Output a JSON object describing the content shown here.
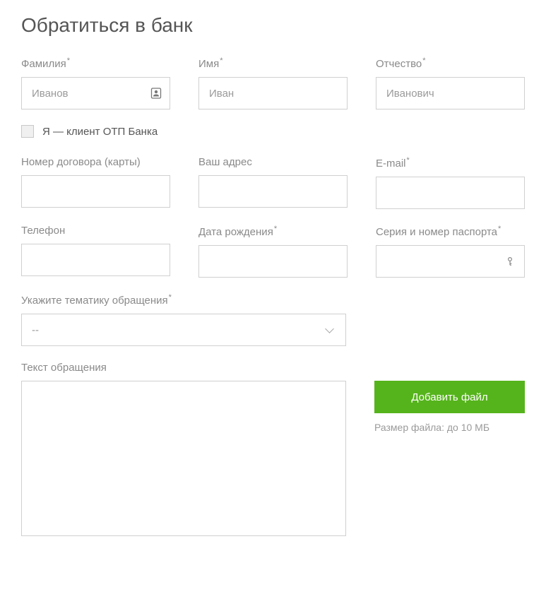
{
  "title": "Обратиться в банк",
  "fields": {
    "lastname": {
      "label": "Фамилия",
      "placeholder": "Иванов",
      "required": true
    },
    "firstname": {
      "label": "Имя",
      "placeholder": "Иван",
      "required": true
    },
    "patronymic": {
      "label": "Отчество",
      "placeholder": "Иванович",
      "required": true
    },
    "client_checkbox": {
      "label": "Я — клиент ОТП Банка"
    },
    "contract": {
      "label": "Номер договора (карты)",
      "required": false
    },
    "address": {
      "label": "Ваш адрес",
      "required": false
    },
    "email": {
      "label": "E-mail",
      "required": true
    },
    "phone": {
      "label": "Телефон",
      "required": false
    },
    "birthdate": {
      "label": "Дата рождения",
      "required": true
    },
    "passport": {
      "label": "Серия и номер паспорта",
      "required": true
    },
    "topic": {
      "label": "Укажите тематику обращения",
      "required": true,
      "selected": "--"
    },
    "message": {
      "label": "Текст обращения"
    }
  },
  "file_upload": {
    "button": "Добавить файл",
    "note": "Размер файла: до 10 МБ"
  }
}
